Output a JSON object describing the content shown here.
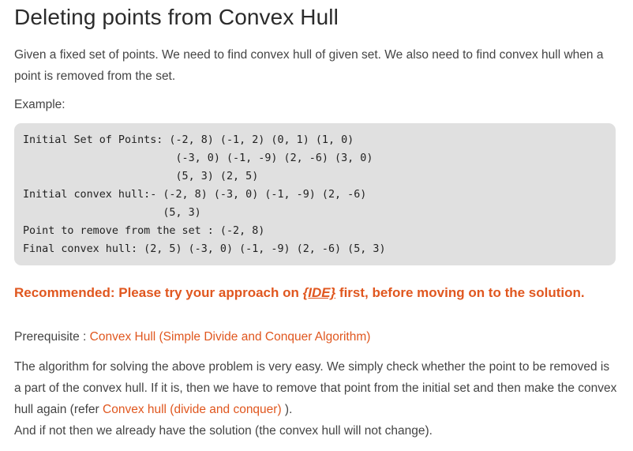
{
  "title": "Deleting points from Convex Hull",
  "intro": "Given a fixed set of points. We need to find convex hull of given set. We also need to find convex hull when a point is removed from the set.",
  "example_label": "Example:",
  "code_lines": [
    "Initial Set of Points: (-2, 8) (-1, 2) (0, 1) (1, 0)",
    "                        (-3, 0) (-1, -9) (2, -6) (3, 0)",
    "                        (5, 3) (2, 5)",
    "Initial convex hull:- (-2, 8) (-3, 0) (-1, -9) (2, -6)",
    "                      (5, 3)",
    "Point to remove from the set : (-2, 8)",
    "Final convex hull: (2, 5) (-3, 0) (-1, -9) (2, -6) (5, 3)"
  ],
  "recommended": {
    "before": "Recommended: Please try your approach on ",
    "ide_link": "{IDE}",
    "after": " first, before moving on to the solution."
  },
  "prerequisite": {
    "label": "Prerequisite : ",
    "link": "Convex Hull (Simple Divide and Conquer Algorithm)"
  },
  "algorithm": {
    "text1": "The algorithm for solving the above problem is very easy. We simply check whether the point to be removed is a part of the convex hull. If it is, then we have to remove that point from the initial set and then make the convex hull again (refer ",
    "link": "Convex hull (divide and conquer)",
    "text2": " ).",
    "text3": "And if not then we already have the solution (the convex hull will not change)."
  },
  "colors": {
    "accent": "#e0571f",
    "code_bg": "#e0e0e0"
  }
}
